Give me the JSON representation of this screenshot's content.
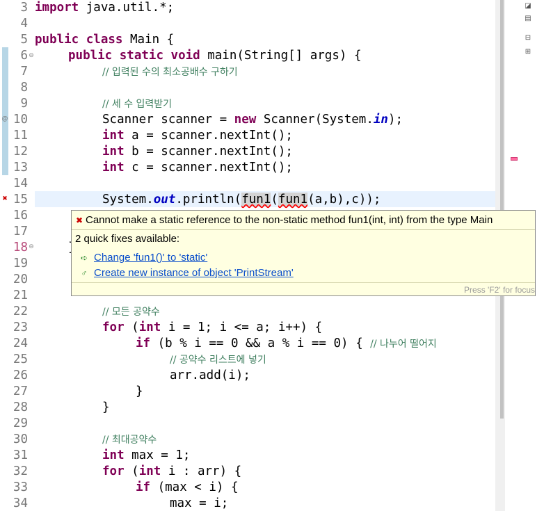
{
  "editor": {
    "line_numbers": [
      "3",
      "4",
      "5",
      "6",
      "7",
      "8",
      "9",
      "10",
      "11",
      "12",
      "13",
      "14",
      "15",
      "16",
      "17",
      "18",
      "19",
      "20",
      "21",
      "22",
      "23",
      "24",
      "25",
      "26",
      "27",
      "28",
      "29",
      "30",
      "31",
      "32",
      "33",
      "34"
    ],
    "lines": {
      "l3": {
        "kw": "import",
        "rest": " java.util.*;"
      },
      "l5": {
        "kw1": "public",
        "kw2": "class",
        "rest": " Main {"
      },
      "l6": {
        "kw1": "public",
        "kw2": "static",
        "kw3": "void",
        "rest": " main(String[] args) {"
      },
      "l7": {
        "comment": "// 입력된 수의 최소공배수 구하기"
      },
      "l9": {
        "comment": "// 세 수 입력받기"
      },
      "l10": {
        "type": "Scanner",
        "var": " scanner",
        "eq": " = ",
        "kw": "new",
        "call": " Scanner(System.",
        "field": "in",
        "end": ");"
      },
      "l11": {
        "kw": "int",
        "rest": " a = scanner.nextInt();"
      },
      "l12": {
        "kw": "int",
        "rest": " b = scanner.nextInt();"
      },
      "l13": {
        "kw": "int",
        "rest": " c = scanner.nextInt();"
      },
      "l15": {
        "pre": "System.",
        "field": "out",
        "mid": ".println(",
        "fun_a": "fun1",
        "paren": "(",
        "fun_b": "fun1",
        "args": "(a,b),c));"
      },
      "l18": {
        "brace": "}"
      },
      "l22": {
        "comment": "// 모든 공약수"
      },
      "l23": {
        "kw1": "for",
        "mid1": " (",
        "kw2": "int",
        "rest": " i = 1; i <= a; i++) {"
      },
      "l24": {
        "kw": "if",
        "rest": " (b % i == 0 && a % i == 0) { ",
        "comment": "// 나누어 떨어지"
      },
      "l25": {
        "comment": "// 공약수 리스트에 넣기"
      },
      "l26": {
        "rest": "arr.add(i);"
      },
      "l27": {
        "rest": "}"
      },
      "l28": {
        "rest": "}"
      },
      "l30": {
        "comment": "// 최대공약수"
      },
      "l31": {
        "kw": "int",
        "rest": " max = 1;"
      },
      "l32": {
        "kw1": "for",
        "mid1": " (",
        "kw2": "int",
        "rest": " i : arr) {"
      },
      "l33": {
        "kw": "if",
        "rest": " (max < i) {"
      },
      "l34": {
        "rest": "max = i;"
      }
    }
  },
  "popup": {
    "title": "Cannot make a static reference to the non-static method fun1(int, int) from the type Main",
    "subtitle": "2 quick fixes available:",
    "fixes": [
      {
        "label": "Change 'fun1()' to 'static'",
        "icon": "change-modifier-icon"
      },
      {
        "label": "Create new instance of object 'PrintStream'",
        "icon": "create-instance-icon"
      }
    ],
    "footer": "Press 'F2' for focus"
  },
  "colors": {
    "keyword": "#7f0055",
    "comment": "#3f7f5f",
    "field": "#0000c0",
    "popup_bg": "#ffffe1",
    "link": "#0a4ecb",
    "error": "#ff0000"
  }
}
